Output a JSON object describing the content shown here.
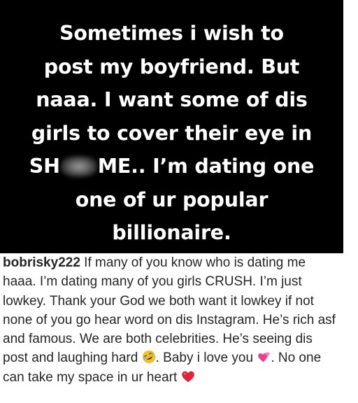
{
  "post_image": {
    "background": "#000000",
    "text_color": "#ffffff",
    "lines": [
      "Sometimes i wish to",
      "post my boyfriend. But",
      "naaa. I want some of dis",
      "girls to cover their eye in"
    ],
    "line5_before": "SH",
    "line5_after": "ME.. I’m dating one",
    "line6": "one of ur popular",
    "line7": "billionaire."
  },
  "caption": {
    "username": "bobrisky222",
    "text_color": "#262626",
    "line1_after_username": " If many of you know who is dating me",
    "line2": "haaa. I’m dating many of you girls CRUSH. I’m just",
    "line3": "lowkey. Thank your God we both want it lowkey if not",
    "line4": "none of you go hear word on dis Instagram. He’s rich asf",
    "line5": "and famous. We are both celebrities. He’s seeing dis",
    "line6_before_emoji": "post and laughing hard ",
    "line6_between": ". Baby i love you ",
    "line6_after": ". No one",
    "line7": "can take my space in ur heart ",
    "emojis": {
      "laughing": "rolling-on-the-floor-laughing-emoji",
      "hearts": "two-hearts-emoji",
      "heart": "red-heart-emoji"
    }
  }
}
